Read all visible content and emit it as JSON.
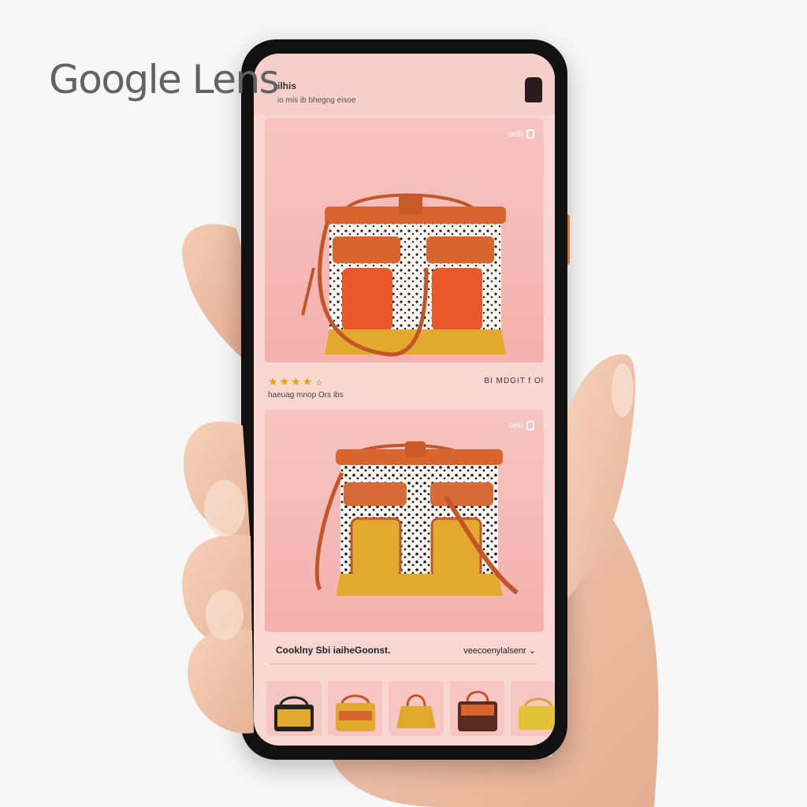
{
  "brand": {
    "wordmark": "Google Lens",
    "color": "#626262"
  },
  "screen": {
    "query_title": "ilhis",
    "query_subtitle": "io mis ib bhegng eisoe",
    "profile_icon": "profile-icon"
  },
  "results": [
    {
      "save_label": "oein",
      "image": "handbag-orange-polka-dot"
    },
    {
      "save_label": "oeln",
      "image": "handbag-yellow-polka-dot"
    }
  ],
  "rating": {
    "stars": "★★★★",
    "extra": "☆",
    "price_text": "BI MDGIT f Ol",
    "seller_text": "haeuag mnop Ors ibs"
  },
  "bottom_row": {
    "left_text": "Cooklny Sbi iaiheGoonst.",
    "right_text": "veecoenylalsenr",
    "chevron_icon": "chevron-down-icon"
  },
  "thumbnails": [
    {
      "label": "bag-thumb-1"
    },
    {
      "label": "bag-thumb-2"
    },
    {
      "label": "bag-thumb-3"
    },
    {
      "label": "bag-thumb-4"
    },
    {
      "label": "bag-thumb-5"
    }
  ],
  "colors": {
    "screen_bg": "#f8d6d2",
    "card_bg": "#f4b1ad",
    "bag_orange": "#d9652c",
    "bag_yellow": "#e3a92f",
    "star": "#e0a800",
    "accent_button": "#e88c3a"
  }
}
